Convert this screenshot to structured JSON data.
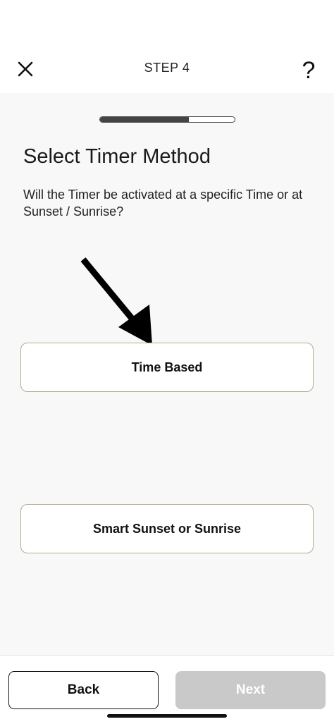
{
  "header": {
    "close_icon": "close-icon",
    "step_label": "STEP 4",
    "help_label": "?"
  },
  "progress": {
    "fraction": 0.66
  },
  "main": {
    "heading": "Select Timer Method",
    "question": "Will the Timer be activated at a specific Time or at Sunset / Sunrise?",
    "arrow_icon": "arrow-down-right-icon",
    "options": [
      {
        "label": "Time Based"
      },
      {
        "label": "Smart Sunset or Sunrise"
      }
    ]
  },
  "footer": {
    "back_label": "Back",
    "next_label": "Next"
  },
  "colors": {
    "option_border": "#b6ab8f",
    "next_disabled": "#c9c9c9",
    "content_bg": "#f8f8f8"
  }
}
